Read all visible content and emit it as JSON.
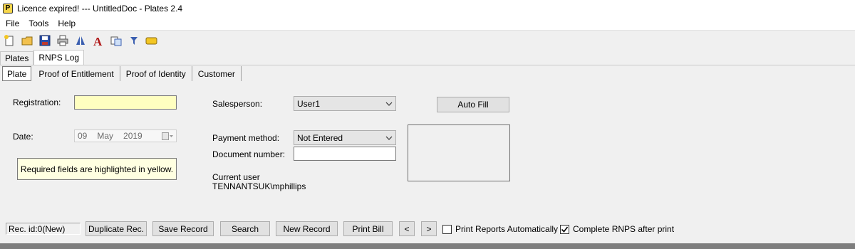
{
  "window": {
    "title": "Licence expired! --- UntitledDoc - Plates 2.4",
    "icon_letter": "P",
    "icon": "plates-app-icon"
  },
  "menu": [
    "File",
    "Tools",
    "Help"
  ],
  "toolbar": {
    "icons": [
      "new-icon",
      "open-icon",
      "save-icon",
      "print-icon",
      "compare-icon",
      "font-icon",
      "copy-icon",
      "filter-icon",
      "message-icon"
    ]
  },
  "outer_tabs": [
    "Plates",
    "RNPS Log"
  ],
  "inner_tabs": [
    "Plate",
    "Proof of Entitlement",
    "Proof of Identity",
    "Customer"
  ],
  "form": {
    "registration_label": "Registration:",
    "registration_value": "",
    "date_label": "Date:",
    "date_day": "09",
    "date_month": "May",
    "date_year": "2019",
    "note": "Required fields are highlighted in yellow.",
    "salesperson_label": "Salesperson:",
    "salesperson_value": "User1",
    "payment_label": "Payment method:",
    "payment_value": "Not Entered",
    "document_label": "Document number:",
    "document_value": "",
    "current_user_label": "Current user",
    "current_user_value": "TENNANTSUK\\mphillips",
    "autofill_label": "Auto Fill"
  },
  "bottom": {
    "rec_id": "Rec. id:0(New)",
    "duplicate": "Duplicate Rec.",
    "save": "Save Record",
    "search": "Search",
    "new": "New Record",
    "print_bill": "Print Bill",
    "prev": "<",
    "next": ">",
    "print_reports_label": "Print Reports Automatically",
    "print_reports_checked": false,
    "complete_rnps_label": "Complete RNPS after print",
    "complete_rnps_checked": true
  },
  "colors": {
    "required_field": "#ffffc0",
    "note_bg": "#ffffe1",
    "window_bg": "#f0f0f0"
  }
}
